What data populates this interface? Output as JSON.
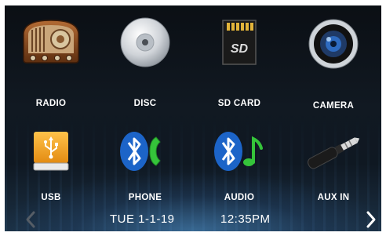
{
  "apps": [
    {
      "label": "RADIO",
      "icon": "radio-icon"
    },
    {
      "label": "DISC",
      "icon": "disc-icon"
    },
    {
      "label": "SD CARD",
      "icon": "sd-card-icon"
    },
    {
      "label": "CAMERA",
      "icon": "camera-icon"
    },
    {
      "label": "USB",
      "icon": "usb-drive-icon"
    },
    {
      "label": "PHONE",
      "icon": "bluetooth-phone-icon"
    },
    {
      "label": "AUDIO",
      "icon": "bluetooth-audio-icon"
    },
    {
      "label": "AUX IN",
      "icon": "aux-jack-icon"
    }
  ],
  "status_bar": {
    "date": "TUE 1-1-19",
    "time": "12:35PM",
    "prev_icon": "chevron-left-icon",
    "next_icon": "chevron-right-icon"
  },
  "colors": {
    "background_top": "#0b0f14",
    "glow": "#5096d2",
    "usb_orange": "#f2a52c",
    "bluetooth_blue": "#1c64c8",
    "phone_green": "#35c43a",
    "label_white": "#ffffff"
  }
}
